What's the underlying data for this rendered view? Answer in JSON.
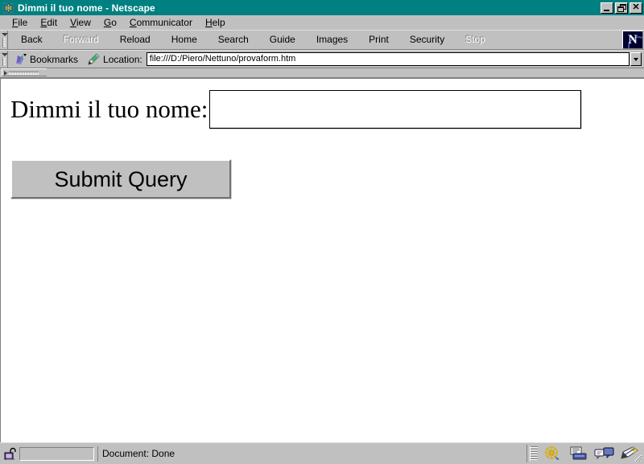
{
  "window": {
    "title": "Dimmi il tuo nome - Netscape",
    "icon": "netscape-window-icon",
    "controls": {
      "minimize": "Minimize",
      "restore": "Restore",
      "close": "Close"
    }
  },
  "menubar": {
    "items": [
      {
        "label": "File",
        "accel": "F"
      },
      {
        "label": "Edit",
        "accel": "E"
      },
      {
        "label": "View",
        "accel": "V"
      },
      {
        "label": "Go",
        "accel": "G"
      },
      {
        "label": "Communicator",
        "accel": "C"
      },
      {
        "label": "Help",
        "accel": "H"
      }
    ]
  },
  "navigation_toolbar": {
    "buttons": [
      {
        "label": "Back",
        "enabled": true
      },
      {
        "label": "Forward",
        "enabled": false
      },
      {
        "label": "Reload",
        "enabled": true
      },
      {
        "label": "Home",
        "enabled": true
      },
      {
        "label": "Search",
        "enabled": true
      },
      {
        "label": "Guide",
        "enabled": true
      },
      {
        "label": "Images",
        "enabled": true
      },
      {
        "label": "Print",
        "enabled": true
      },
      {
        "label": "Security",
        "enabled": true
      },
      {
        "label": "Stop",
        "enabled": false
      }
    ],
    "logo": {
      "letter": "N",
      "name": "netscape-logo"
    }
  },
  "location_toolbar": {
    "bookmarks_label": "Bookmarks",
    "bookmarks_icon": "bookmark-ribbon-icon",
    "location_label": "Location:",
    "location_icon": "pencil-icon",
    "url": "file:///D:/Piero/Nettuno/provaform.htm",
    "url_placeholder": "Location:",
    "dropdown_icon": "chevron-down-icon"
  },
  "page": {
    "prompt_label": "Dimmi il tuo nome:",
    "name_field_value": "",
    "name_field_placeholder": "",
    "submit_label": "Submit Query"
  },
  "statusbar": {
    "security_icon": "unlocked-padlock-icon",
    "status_text": "Document: Done",
    "components": [
      {
        "name": "navigator-icon",
        "title": "Navigator"
      },
      {
        "name": "mailbox-icon",
        "title": "Mailbox"
      },
      {
        "name": "discussions-icon",
        "title": "Discussions"
      },
      {
        "name": "composer-icon",
        "title": "Composer"
      }
    ]
  },
  "colors": {
    "titlebar": "#008080",
    "chrome": "#c0c0c0",
    "content": "#ffffff",
    "disabled_text": "#808080",
    "shadow": "#808080",
    "highlight": "#ffffff"
  }
}
